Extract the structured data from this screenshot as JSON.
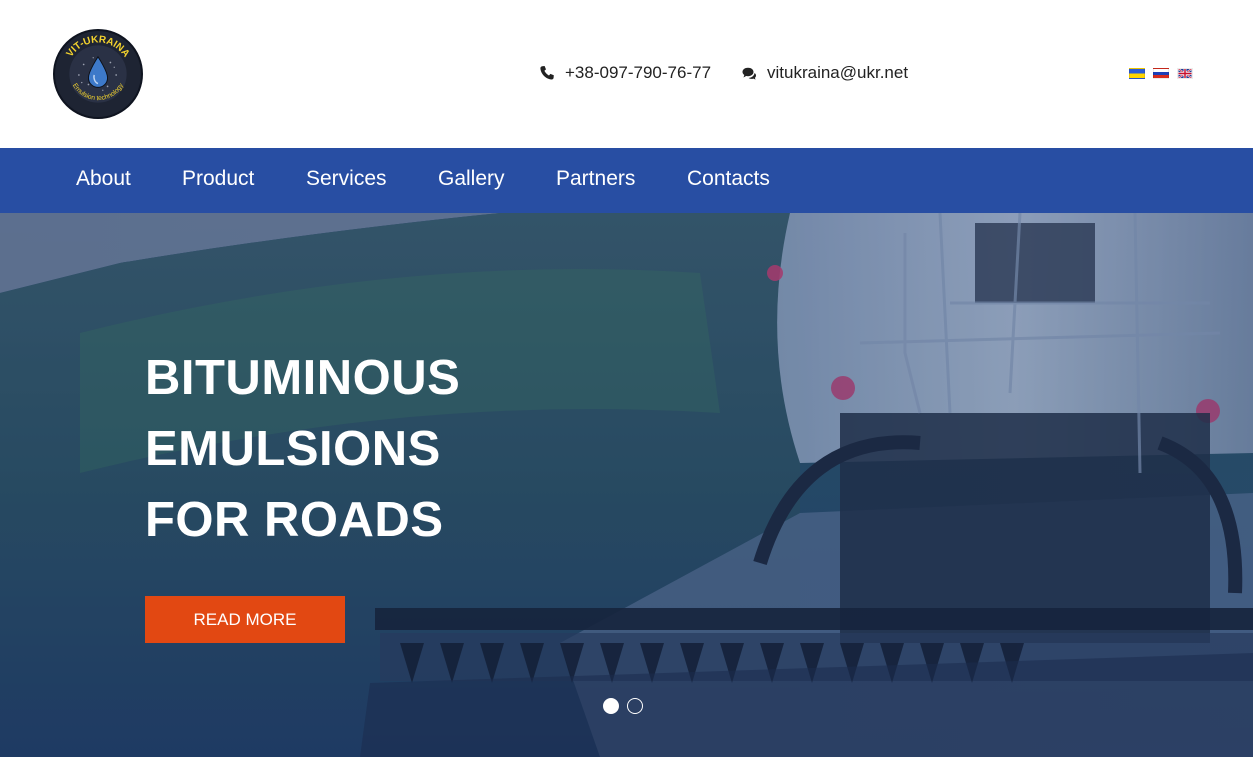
{
  "header": {
    "logo": {
      "top_text": "VIT-UKRAINA",
      "bottom_text": "Emulsion technology"
    },
    "phone": "+38-097-790-76-77",
    "email": "vitukraina@ukr.net",
    "languages": [
      "ua",
      "ru",
      "en"
    ]
  },
  "nav": {
    "items": [
      {
        "label": "About"
      },
      {
        "label": "Product"
      },
      {
        "label": "Services"
      },
      {
        "label": "Gallery"
      },
      {
        "label": "Partners"
      },
      {
        "label": "Contacts"
      }
    ]
  },
  "hero": {
    "title_lines": [
      "BITUMINOUS",
      "EMULSIONS",
      "FOR ROADS"
    ],
    "cta_label": "READ MORE",
    "slides_count": 2,
    "active_slide": 1
  },
  "colors": {
    "nav_bg": "#284ea3",
    "cta_bg": "#e24812",
    "logo_bg": "#1e2433",
    "logo_text": "#f2d22e"
  }
}
